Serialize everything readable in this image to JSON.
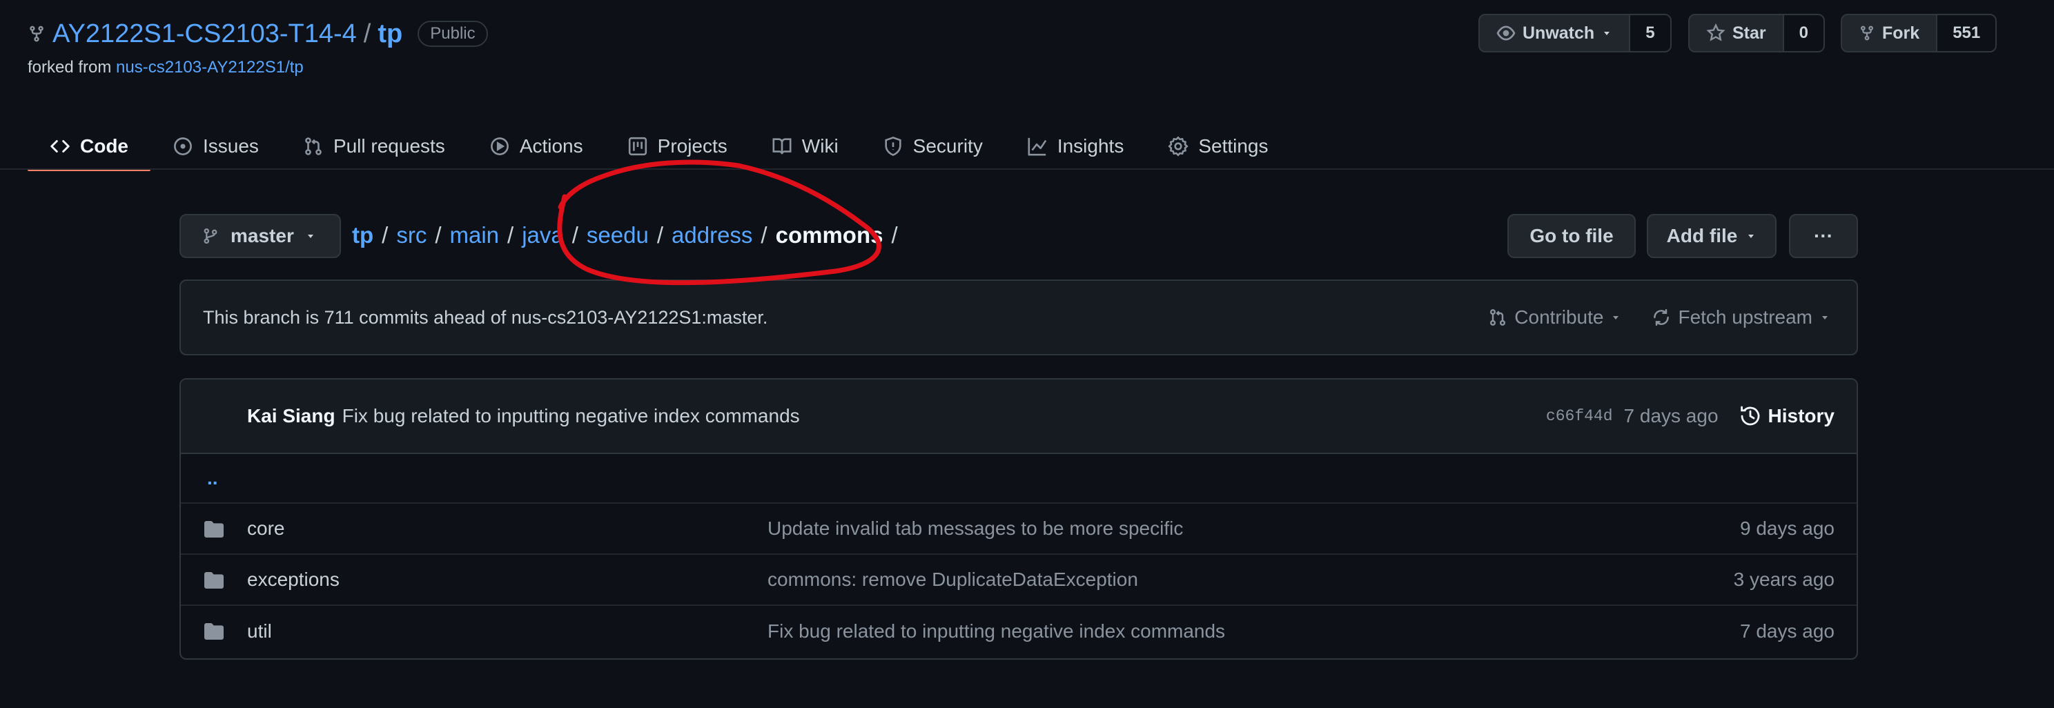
{
  "repo": {
    "owner": "AY2122S1-CS2103-T14-4",
    "separator": "/",
    "name": "tp",
    "visibility": "Public",
    "forked_prefix": "forked from ",
    "forked_source": "nus-cs2103-AY2122S1/tp"
  },
  "repo_actions": {
    "watch_label": "Unwatch",
    "watch_count": "5",
    "star_label": "Star",
    "star_count": "0",
    "fork_label": "Fork",
    "fork_count": "551"
  },
  "nav": {
    "tabs": [
      {
        "label": "Code",
        "icon": "code-icon",
        "active": true
      },
      {
        "label": "Issues",
        "icon": "issue-icon"
      },
      {
        "label": "Pull requests",
        "icon": "pull-request-icon"
      },
      {
        "label": "Actions",
        "icon": "play-icon"
      },
      {
        "label": "Projects",
        "icon": "project-icon"
      },
      {
        "label": "Wiki",
        "icon": "book-icon"
      },
      {
        "label": "Security",
        "icon": "shield-icon"
      },
      {
        "label": "Insights",
        "icon": "graph-icon"
      },
      {
        "label": "Settings",
        "icon": "gear-icon"
      }
    ]
  },
  "toolbar": {
    "branch": "master",
    "breadcrumb": [
      {
        "label": "tp",
        "type": "root"
      },
      {
        "label": "src",
        "type": "link"
      },
      {
        "label": "main",
        "type": "link"
      },
      {
        "label": "java",
        "type": "link"
      },
      {
        "label": "seedu",
        "type": "link"
      },
      {
        "label": "address",
        "type": "link"
      },
      {
        "label": "commons",
        "type": "current"
      }
    ],
    "separator": "/",
    "go_to_file": "Go to file",
    "add_file": "Add file",
    "more": "···"
  },
  "branch_info": {
    "message": "This branch is 711 commits ahead of nus-cs2103-AY2122S1:master.",
    "contribute": "Contribute",
    "fetch_upstream": "Fetch upstream"
  },
  "latest_commit": {
    "author": "Kai Siang",
    "message": "Fix bug related to inputting negative index commands",
    "sha": "c66f44d",
    "time": "7 days ago",
    "history": "History"
  },
  "files": {
    "parent": "..",
    "rows": [
      {
        "name": "core",
        "message": "Update invalid tab messages to be more specific",
        "time": "9 days ago"
      },
      {
        "name": "exceptions",
        "message": "commons: remove DuplicateDataException",
        "time": "3 years ago"
      },
      {
        "name": "util",
        "message": "Fix bug related to inputting negative index commands",
        "time": "7 days ago"
      }
    ]
  },
  "colors": {
    "background": "#0d1117",
    "link": "#58a6ff",
    "annotation": "#e0101a",
    "active_tab_underline": "#f78166"
  }
}
